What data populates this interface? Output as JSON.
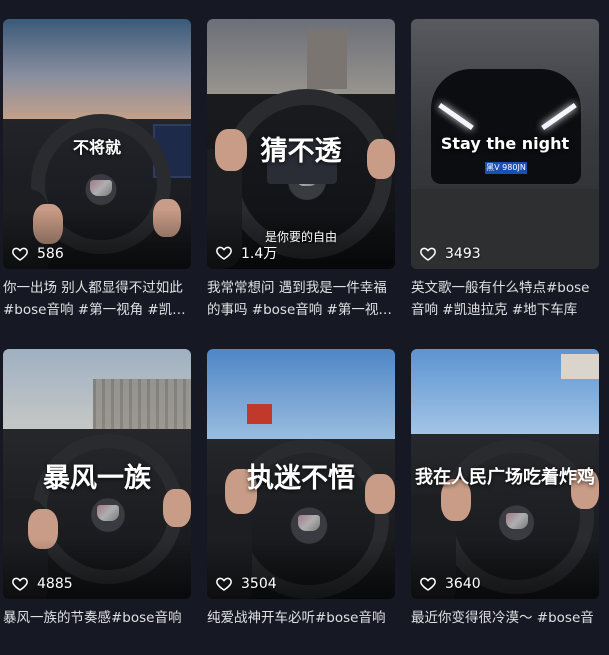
{
  "videos": [
    {
      "overlay": "不将就",
      "likes": "586",
      "caption": "你一出场 别人都显得不过如此 #bose音响 #第一视角 #凯…"
    },
    {
      "overlay": "猜不透",
      "subtitle": "是你要的自由",
      "likes": "1.4万",
      "caption": "我常常想问 遇到我是一件幸福的事吗 #bose音响 #第一视…"
    },
    {
      "overlay": "Stay the night",
      "plate": "黑V 980JN",
      "likes": "3493",
      "caption": "英文歌一般有什么特点#bose音响 #凯迪拉克 #地下车库"
    },
    {
      "overlay": "暴风一族",
      "likes": "4885",
      "caption": "暴风一族的节奏感#bose音响"
    },
    {
      "overlay": "执迷不悟",
      "likes": "3504",
      "caption": "纯爱战神开车必听#bose音响"
    },
    {
      "overlay": "我在人民广场吃着炸鸡",
      "likes": "3640",
      "caption": "最近你变得很冷漠～ #bose音"
    }
  ],
  "icons": {
    "like": "heart-outline-icon"
  }
}
